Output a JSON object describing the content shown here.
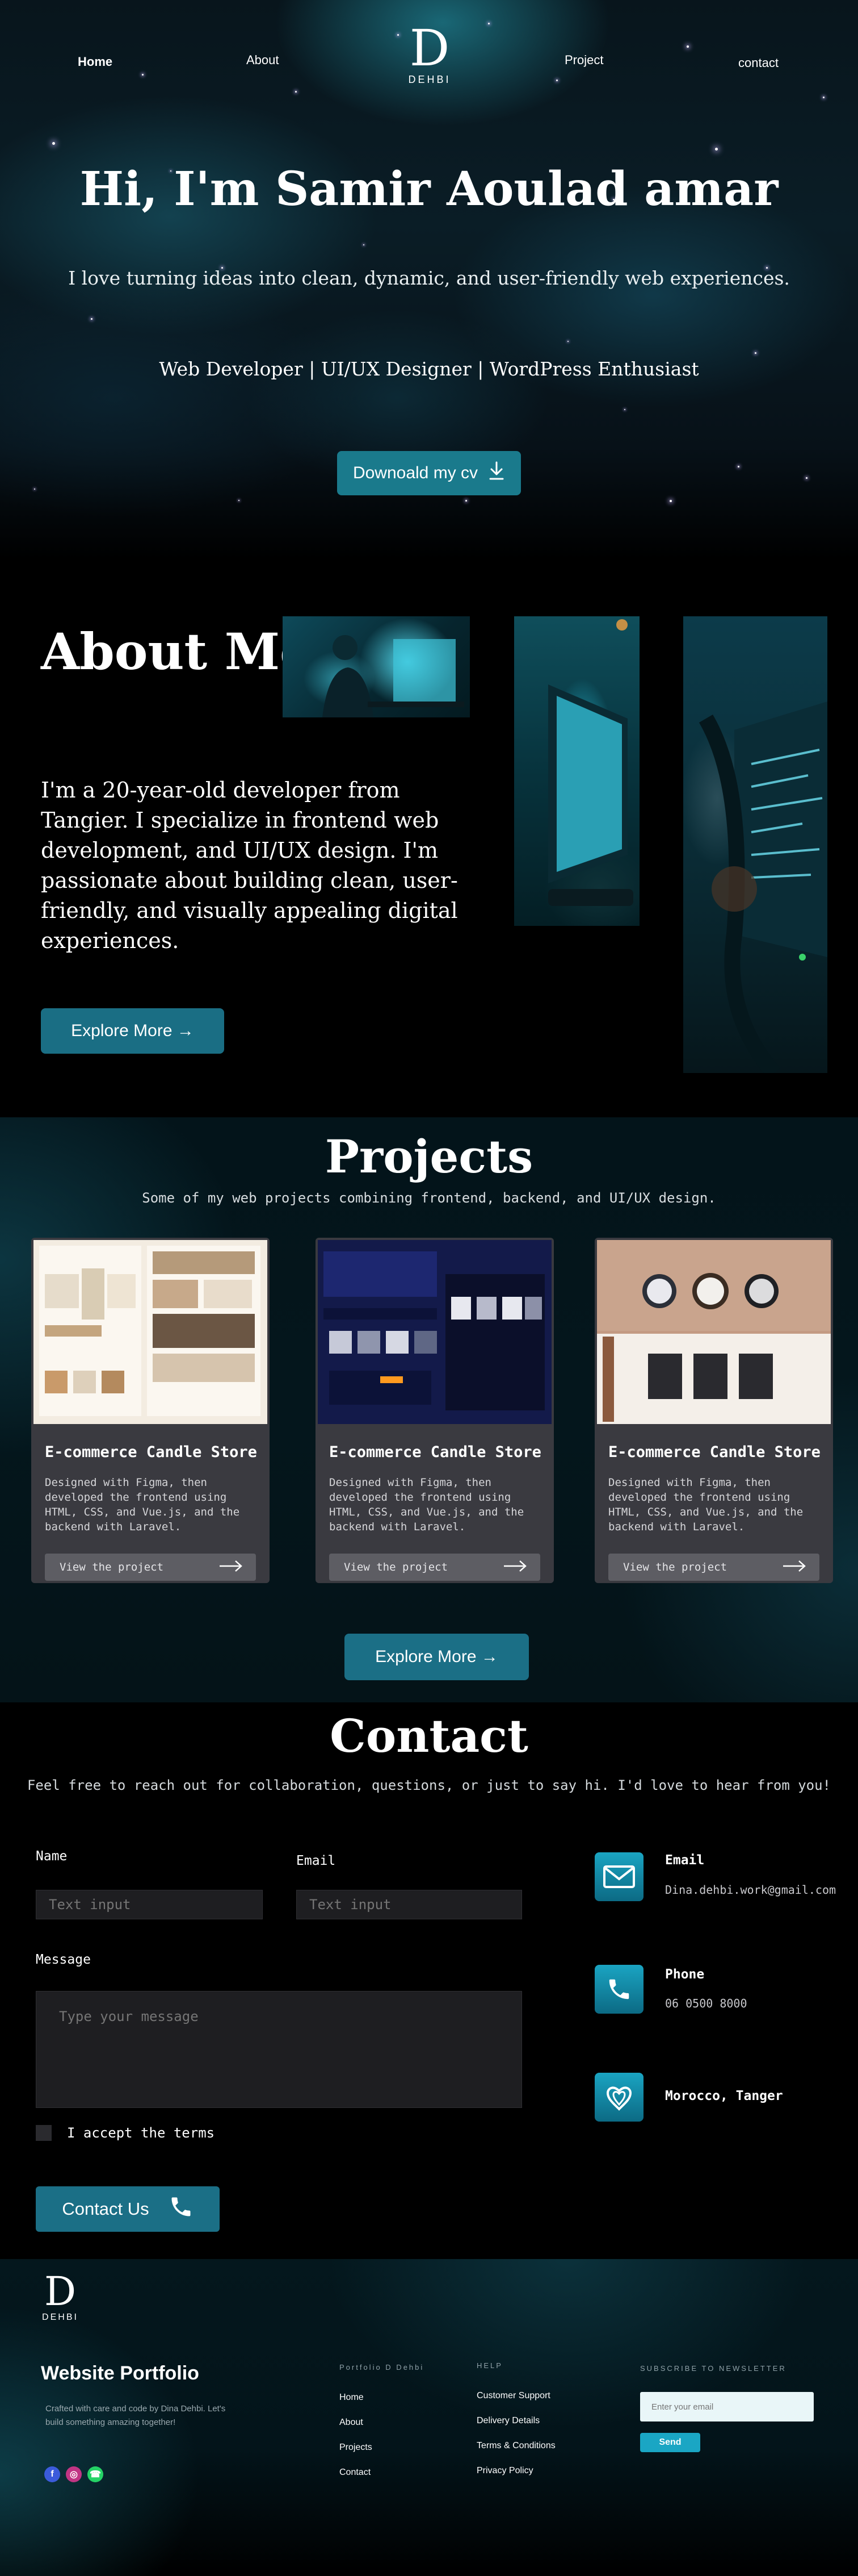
{
  "nav": {
    "home": "Home",
    "about": "About",
    "project": "Project",
    "contact": "contact"
  },
  "logo": {
    "mark": "D",
    "text": "DEHBI"
  },
  "hero": {
    "title": "Hi, I'm Samir Aoulad amar",
    "intro": "I love turning ideas into clean, dynamic, and user-friendly web experiences.",
    "roles": "Web Developer | UI/UX Designer | WordPress Enthusiast",
    "cv_button": "Downoald my cv",
    "cv_icon": "download-icon"
  },
  "about": {
    "title": "About Me",
    "text": "I'm a 20-year-old developer from Tangier. I specialize in frontend web development, and UI/UX design. I'm passionate about building clean, user-friendly, and visually appealing digital experiences.",
    "button": "Explore More →"
  },
  "projects": {
    "title": "Projects",
    "subtitle": "Some of my web projects combining frontend, backend, and UI/UX design.",
    "cards": [
      {
        "title": "E-commerce Candle Store",
        "desc": "Designed with Figma, then developed the frontend using HTML, CSS, and Vue.js, and the backend with Laravel.",
        "button": "View the project"
      },
      {
        "title": "E-commerce Candle Store",
        "desc": "Designed with Figma, then developed the frontend using HTML, CSS, and Vue.js, and the backend with Laravel.",
        "button": "View the project"
      },
      {
        "title": "E-commerce Candle Store",
        "desc": "Designed with Figma, then developed the frontend using HTML, CSS, and Vue.js, and the backend with Laravel.",
        "button": "View the project"
      }
    ],
    "more_button": "Explore More →"
  },
  "contact": {
    "title": "Contact",
    "subtitle": "Feel free to reach out for collaboration, questions, or just to say hi. I'd love to hear from you!",
    "name_label": "Name",
    "email_label": "Email",
    "name_placeholder": "Text input",
    "email_placeholder": "Text input",
    "message_label": "Message",
    "message_placeholder": "Type your message",
    "terms": "I accept the terms",
    "button": "Contact Us",
    "info": [
      {
        "title": "Email",
        "value": "Dina.dehbi.work@gmail.com",
        "icon": "mail-icon"
      },
      {
        "title": "Phone",
        "value": "06 0500 8000",
        "icon": "phone-icon"
      },
      {
        "title": "Morocco, Tanger",
        "value": "",
        "icon": "location-icon"
      }
    ]
  },
  "footer": {
    "logo_mark": "D",
    "logo_text": "DEHBI",
    "name": "Website Portfolio",
    "tagline": "Crafted with care and code by Dina Dehbi. Let's build something amazing together!",
    "col1_head": "Portfolio D Dehbi",
    "col1_links": [
      "Home",
      "About",
      "Projects",
      "Contact"
    ],
    "col2_head": "HELP",
    "col2_links": [
      "Customer Support",
      "Delivery Details",
      "Terms & Conditions",
      "Privacy Policy"
    ],
    "newsletter_head": "SUBSCRIBE TO NEWSLETTER",
    "email_placeholder": "Enter your email",
    "send": "Send",
    "social": [
      {
        "icon": "facebook-icon",
        "glyph": "f",
        "color": "#3b5bdb"
      },
      {
        "icon": "instagram-icon",
        "glyph": "◎",
        "color": "#c13584"
      },
      {
        "icon": "whatsapp-icon",
        "glyph": "☎",
        "color": "#25d366"
      }
    ]
  },
  "colors": {
    "accent": "#1b6f86",
    "accent_light": "#1aa6c4",
    "card": "#3a3a40"
  }
}
